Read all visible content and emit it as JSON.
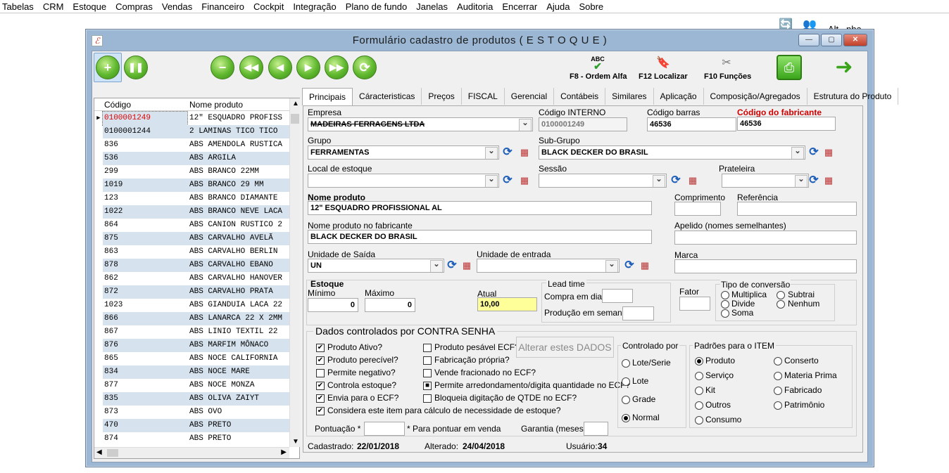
{
  "menu": [
    "Tabelas",
    "CRM",
    "Estoque",
    "Compras",
    "Vendas",
    "Financeiro",
    "Cockpit",
    "Integração",
    "Plano de fundo",
    "Janelas",
    "Auditoria",
    "Encerrar",
    "Ajuda",
    "Sobre"
  ],
  "top_user_text": "Alt...nha",
  "window": {
    "title": "Formulário cadastro de produtos ( E S T O Q U E )",
    "minimize": "—",
    "maximize": "▢",
    "close": "✕"
  },
  "toolbar": {
    "f8": "F8 - Ordem Alfa",
    "f12": "F12 Localizar",
    "f10": "F10 Funções",
    "abc_label": "ABC"
  },
  "grid": {
    "col_code": "Código",
    "col_name": "Nome produto",
    "rows": [
      [
        "0100001249",
        "12\" ESQUADRO PROFISS"
      ],
      [
        "0100001244",
        "2 LAMINAS TICO TICO"
      ],
      [
        "836",
        "ABS AMENDOLA RUSTICA"
      ],
      [
        "536",
        "ABS ARGILA"
      ],
      [
        "299",
        "ABS BRANCO 22MM"
      ],
      [
        "1019",
        "ABS BRANCO 29 MM"
      ],
      [
        "123",
        "ABS BRANCO DIAMANTE"
      ],
      [
        "1022",
        "ABS BRANCO NEVE LACA"
      ],
      [
        "864",
        "ABS CANION RUSTICO 2"
      ],
      [
        "875",
        "ABS CARVALHO AVELÃ"
      ],
      [
        "863",
        "ABS CARVALHO BERLIN"
      ],
      [
        "878",
        "ABS CARVALHO EBANO"
      ],
      [
        "862",
        "ABS CARVALHO HANOVER"
      ],
      [
        "872",
        "ABS CARVALHO PRATA"
      ],
      [
        "1023",
        "ABS GIANDUIA LACA 22"
      ],
      [
        "866",
        "ABS LANARCA 22 X 2MM"
      ],
      [
        "867",
        "ABS LINIO TEXTIL 22"
      ],
      [
        "876",
        "ABS MARFIM MÔNACO"
      ],
      [
        "865",
        "ABS NOCE CALIFORNIA"
      ],
      [
        "834",
        "ABS NOCE MARE"
      ],
      [
        "877",
        "ABS NOCE MONZA"
      ],
      [
        "835",
        "ABS OLIVA ZAIYT"
      ],
      [
        "873",
        "ABS OVO"
      ],
      [
        "470",
        "ABS PRETO"
      ],
      [
        "874",
        "ABS PRETO"
      ]
    ]
  },
  "tabs": [
    "Principais",
    "Cáracteristicas",
    "Preços",
    "FISCAL",
    "Gerencial",
    "Contábeis",
    "Similares",
    "Aplicação",
    "Composição/Agregados",
    "Estrutura do Produto"
  ],
  "form": {
    "empresa_label": "Empresa",
    "empresa_value": "MADEIRAS FERRAGENS LTDA",
    "codigo_interno_label": "Código INTERNO",
    "codigo_interno_value": "0100001249",
    "codigo_barras_label": "Código barras",
    "codigo_barras_value": "46536",
    "codigo_fabricante_label": "Código do fabricante",
    "codigo_fabricante_value": "46536",
    "grupo_label": "Grupo",
    "grupo_value": "FERRAMENTAS",
    "subgrupo_label": "Sub-Grupo",
    "subgrupo_value": "BLACK DECKER DO BRASIL",
    "local_label": "Local de estoque",
    "sessao_label": "Sessão",
    "prateleira_label": "Prateleira",
    "nome_label": "Nome produto",
    "nome_value": "12\" ESQUADRO PROFISSIONAL AL",
    "comprimento_label": "Comprimento",
    "referencia_label": "Referência",
    "nome_fab_label": "Nome produto no fabricante",
    "nome_fab_value": "BLACK DECKER DO BRASIL",
    "apelido_label": "Apelido (nomes semelhantes)",
    "unidade_saida_label": "Unidade de Saída",
    "unidade_saida_value": "UN",
    "unidade_entrada_label": "Unidade de entrada",
    "marca_label": "Marca",
    "estoque_label": "Estoque",
    "minimo_label": "Mínimo",
    "minimo_value": "0",
    "maximo_label": "Máximo",
    "maximo_value": "0",
    "atual_label": "Atual",
    "atual_value": "10,00",
    "lead_label": "Lead time",
    "compra_dias_label": "Compra em dias",
    "producao_label": "Produção em semanas",
    "fator_label": "Fator",
    "tipo_conv_label": "Tipo de conversão",
    "tipo_conv": [
      "Multiplica",
      "Subtrai",
      "Divide",
      "Nenhum",
      "Soma"
    ]
  },
  "senha": {
    "title": "Dados controlados por CONTRA SENHA",
    "checks_left": [
      {
        "label": "Produto Ativo?",
        "checked": true
      },
      {
        "label": "Produto perecível?",
        "checked": true
      },
      {
        "label": "Permite negativo?",
        "checked": false
      },
      {
        "label": "Controla estoque?",
        "checked": true
      },
      {
        "label": "Envia para o ECF?",
        "checked": true
      },
      {
        "label": "Considera este item para cálculo de necessidade de estoque?",
        "checked": true
      }
    ],
    "checks_right": [
      {
        "label": "Produto pesável ECF?",
        "checked": false
      },
      {
        "label": "Fabricação própria?",
        "checked": false
      },
      {
        "label": "Vende fracionado no ECF?",
        "checked": false
      },
      {
        "label": "Permite arredondamento/digita quantidade no ECF?",
        "checked": true
      },
      {
        "label": "Bloqueia digitação de QTDE no ECF?",
        "checked": false
      }
    ],
    "alter_button": "Alterar estes DADOS",
    "controlado_label": "Controlado por",
    "controlado": [
      {
        "label": "Lote/Serie",
        "on": false
      },
      {
        "label": "Lote",
        "on": false
      },
      {
        "label": "Grade",
        "on": false
      },
      {
        "label": "Normal",
        "on": true
      }
    ],
    "padroes_label": "Padrões para o ITEM",
    "padroes": [
      {
        "label": "Produto",
        "on": true
      },
      {
        "label": "Conserto",
        "on": false
      },
      {
        "label": "Serviço",
        "on": false
      },
      {
        "label": "Materia Prima",
        "on": false
      },
      {
        "label": "Kit",
        "on": false
      },
      {
        "label": "Fabricado",
        "on": false
      },
      {
        "label": "Outros",
        "on": false
      },
      {
        "label": "Patrimônio",
        "on": false
      },
      {
        "label": "Consumo",
        "on": false
      }
    ],
    "pontuacao_label": "Pontuação *",
    "pontuacao_note": "* Para pontuar em venda",
    "garantia_label": "Garantia (meses)"
  },
  "footer": {
    "cadastrado_label": "Cadastrado:",
    "cadastrado_value": "22/01/2018",
    "alterado_label": "Alterado:",
    "alterado_value": "24/04/2018",
    "usuario_label": "Usuário:",
    "usuario_value": "34"
  }
}
